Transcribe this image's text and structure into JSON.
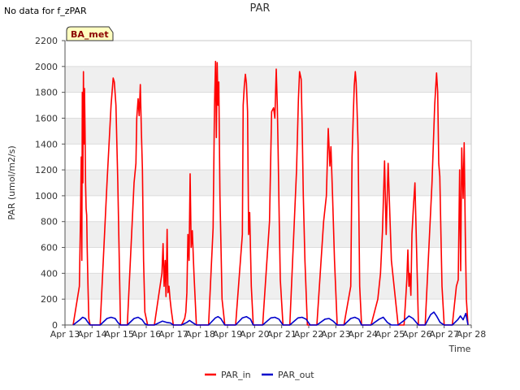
{
  "page": {
    "note": "No data for f_zPAR"
  },
  "chart_data": {
    "type": "line",
    "title": "PAR",
    "xlabel": "Time",
    "ylabel": "PAR (umol/m2/s)",
    "ylim": [
      0,
      2200
    ],
    "yticks": [
      0,
      200,
      400,
      600,
      800,
      1000,
      1200,
      1400,
      1600,
      1800,
      2000,
      2200
    ],
    "xlim_days": [
      0,
      15
    ],
    "xtick_labels": [
      "Apr 13",
      "Apr 14",
      "Apr 15",
      "Apr 16",
      "Apr 17",
      "Apr 18",
      "Apr 19",
      "Apr 20",
      "Apr 21",
      "Apr 22",
      "Apr 23",
      "Apr 24",
      "Apr 25",
      "Apr 26",
      "Apr 27",
      "Apr 28"
    ],
    "grid_bands": true,
    "station_label": "BA_met",
    "legend_position": "bottom-center",
    "series": [
      {
        "name": "PAR_in",
        "color": "#ff0000",
        "x": [
          0.3,
          0.53,
          0.57,
          0.6,
          0.62,
          0.64,
          0.66,
          0.68,
          0.7,
          0.72,
          0.74,
          0.76,
          0.78,
          0.8,
          0.82,
          0.85,
          0.88,
          0.93,
          1.3,
          1.55,
          1.7,
          1.78,
          1.82,
          1.88,
          1.95,
          2.05,
          2.3,
          2.55,
          2.62,
          2.65,
          2.7,
          2.74,
          2.78,
          2.82,
          2.86,
          2.9,
          2.95,
          3.05,
          3.3,
          3.58,
          3.62,
          3.66,
          3.7,
          3.73,
          3.77,
          3.8,
          3.84,
          3.88,
          3.92,
          4.0,
          4.3,
          4.42,
          4.46,
          4.5,
          4.54,
          4.58,
          4.62,
          4.66,
          4.7,
          4.76,
          4.85,
          5.3,
          5.47,
          5.52,
          5.56,
          5.59,
          5.62,
          5.65,
          5.68,
          5.72,
          5.8,
          5.9,
          6.3,
          6.55,
          6.58,
          6.62,
          6.66,
          6.7,
          6.74,
          6.78,
          6.82,
          6.88,
          6.95,
          7.3,
          7.55,
          7.63,
          7.7,
          7.75,
          7.8,
          7.84,
          7.87,
          7.91,
          7.95,
          8.05,
          8.3,
          8.55,
          8.62,
          8.66,
          8.72,
          8.76,
          8.8,
          8.86,
          8.95,
          9.05,
          9.3,
          9.55,
          9.65,
          9.72,
          9.78,
          9.82,
          9.88,
          9.95,
          10.05,
          10.3,
          10.55,
          10.6,
          10.64,
          10.68,
          10.72,
          10.75,
          10.78,
          10.82,
          10.88,
          10.95,
          11.3,
          11.55,
          11.65,
          11.72,
          11.8,
          11.86,
          11.93,
          12.05,
          12.3,
          12.52,
          12.58,
          12.62,
          12.66,
          12.7,
          12.73,
          12.77,
          12.81,
          12.86,
          12.92,
          13.05,
          13.3,
          13.55,
          13.65,
          13.72,
          13.76,
          13.8,
          13.84,
          13.88,
          13.92,
          14.0,
          14.3,
          14.45,
          14.52,
          14.57,
          14.61,
          14.65,
          14.7,
          14.74,
          14.78,
          14.82,
          14.88
        ],
        "y": [
          0,
          300,
          800,
          1300,
          500,
          1800,
          1100,
          1960,
          1400,
          1830,
          1500,
          1100,
          900,
          850,
          600,
          300,
          50,
          0,
          0,
          1100,
          1700,
          1910,
          1880,
          1700,
          1100,
          0,
          0,
          1100,
          1250,
          1600,
          1750,
          1620,
          1860,
          1500,
          1200,
          500,
          100,
          0,
          0,
          400,
          630,
          300,
          500,
          220,
          740,
          250,
          300,
          200,
          120,
          0,
          0,
          50,
          100,
          250,
          700,
          500,
          1170,
          600,
          730,
          400,
          0,
          0,
          750,
          1700,
          2040,
          1450,
          2030,
          1700,
          1880,
          1000,
          200,
          0,
          0,
          700,
          1700,
          1850,
          1940,
          1870,
          1650,
          700,
          870,
          300,
          0,
          0,
          800,
          1650,
          1680,
          1600,
          1980,
          1700,
          1350,
          800,
          350,
          0,
          0,
          1200,
          1750,
          1960,
          1900,
          1500,
          1000,
          500,
          0,
          0,
          0,
          800,
          1000,
          1520,
          1230,
          1380,
          1000,
          500,
          0,
          0,
          300,
          1300,
          1600,
          1850,
          1960,
          1880,
          1700,
          1400,
          300,
          0,
          0,
          200,
          400,
          720,
          1270,
          700,
          1250,
          500,
          0,
          0,
          200,
          350,
          580,
          300,
          400,
          230,
          700,
          900,
          1100,
          0,
          0,
          1100,
          1700,
          1950,
          1800,
          1250,
          1150,
          700,
          300,
          0,
          0,
          300,
          350,
          1200,
          420,
          1370,
          980,
          1410,
          700,
          200,
          0
        ]
      },
      {
        "name": "PAR_out",
        "color": "#0000cc",
        "x": [
          0.3,
          0.55,
          0.65,
          0.75,
          0.85,
          0.93,
          1.3,
          1.55,
          1.7,
          1.85,
          1.95,
          2.05,
          2.3,
          2.55,
          2.7,
          2.85,
          2.95,
          3.05,
          3.3,
          3.6,
          3.75,
          3.9,
          4.0,
          4.3,
          4.5,
          4.6,
          4.7,
          4.85,
          5.3,
          5.55,
          5.65,
          5.75,
          5.9,
          6.3,
          6.55,
          6.7,
          6.85,
          6.95,
          7.3,
          7.6,
          7.75,
          7.9,
          8.05,
          8.3,
          8.6,
          8.75,
          8.9,
          9.05,
          9.3,
          9.6,
          9.75,
          9.9,
          10.05,
          10.3,
          10.55,
          10.7,
          10.85,
          10.95,
          11.3,
          11.6,
          11.75,
          11.9,
          12.05,
          12.3,
          12.55,
          12.7,
          12.85,
          13.05,
          13.3,
          13.5,
          13.62,
          13.72,
          13.85,
          14.0,
          14.3,
          14.5,
          14.6,
          14.7,
          14.8,
          14.88
        ],
        "y": [
          0,
          40,
          60,
          50,
          20,
          0,
          0,
          50,
          60,
          50,
          20,
          0,
          0,
          50,
          60,
          40,
          10,
          0,
          0,
          30,
          20,
          15,
          0,
          0,
          20,
          35,
          20,
          0,
          0,
          55,
          65,
          50,
          0,
          0,
          55,
          65,
          45,
          0,
          0,
          55,
          60,
          45,
          0,
          0,
          55,
          60,
          45,
          0,
          0,
          45,
          50,
          30,
          0,
          0,
          50,
          60,
          45,
          0,
          0,
          45,
          60,
          20,
          0,
          0,
          40,
          70,
          50,
          0,
          0,
          80,
          100,
          70,
          20,
          0,
          0,
          40,
          70,
          40,
          90,
          0
        ]
      }
    ]
  }
}
